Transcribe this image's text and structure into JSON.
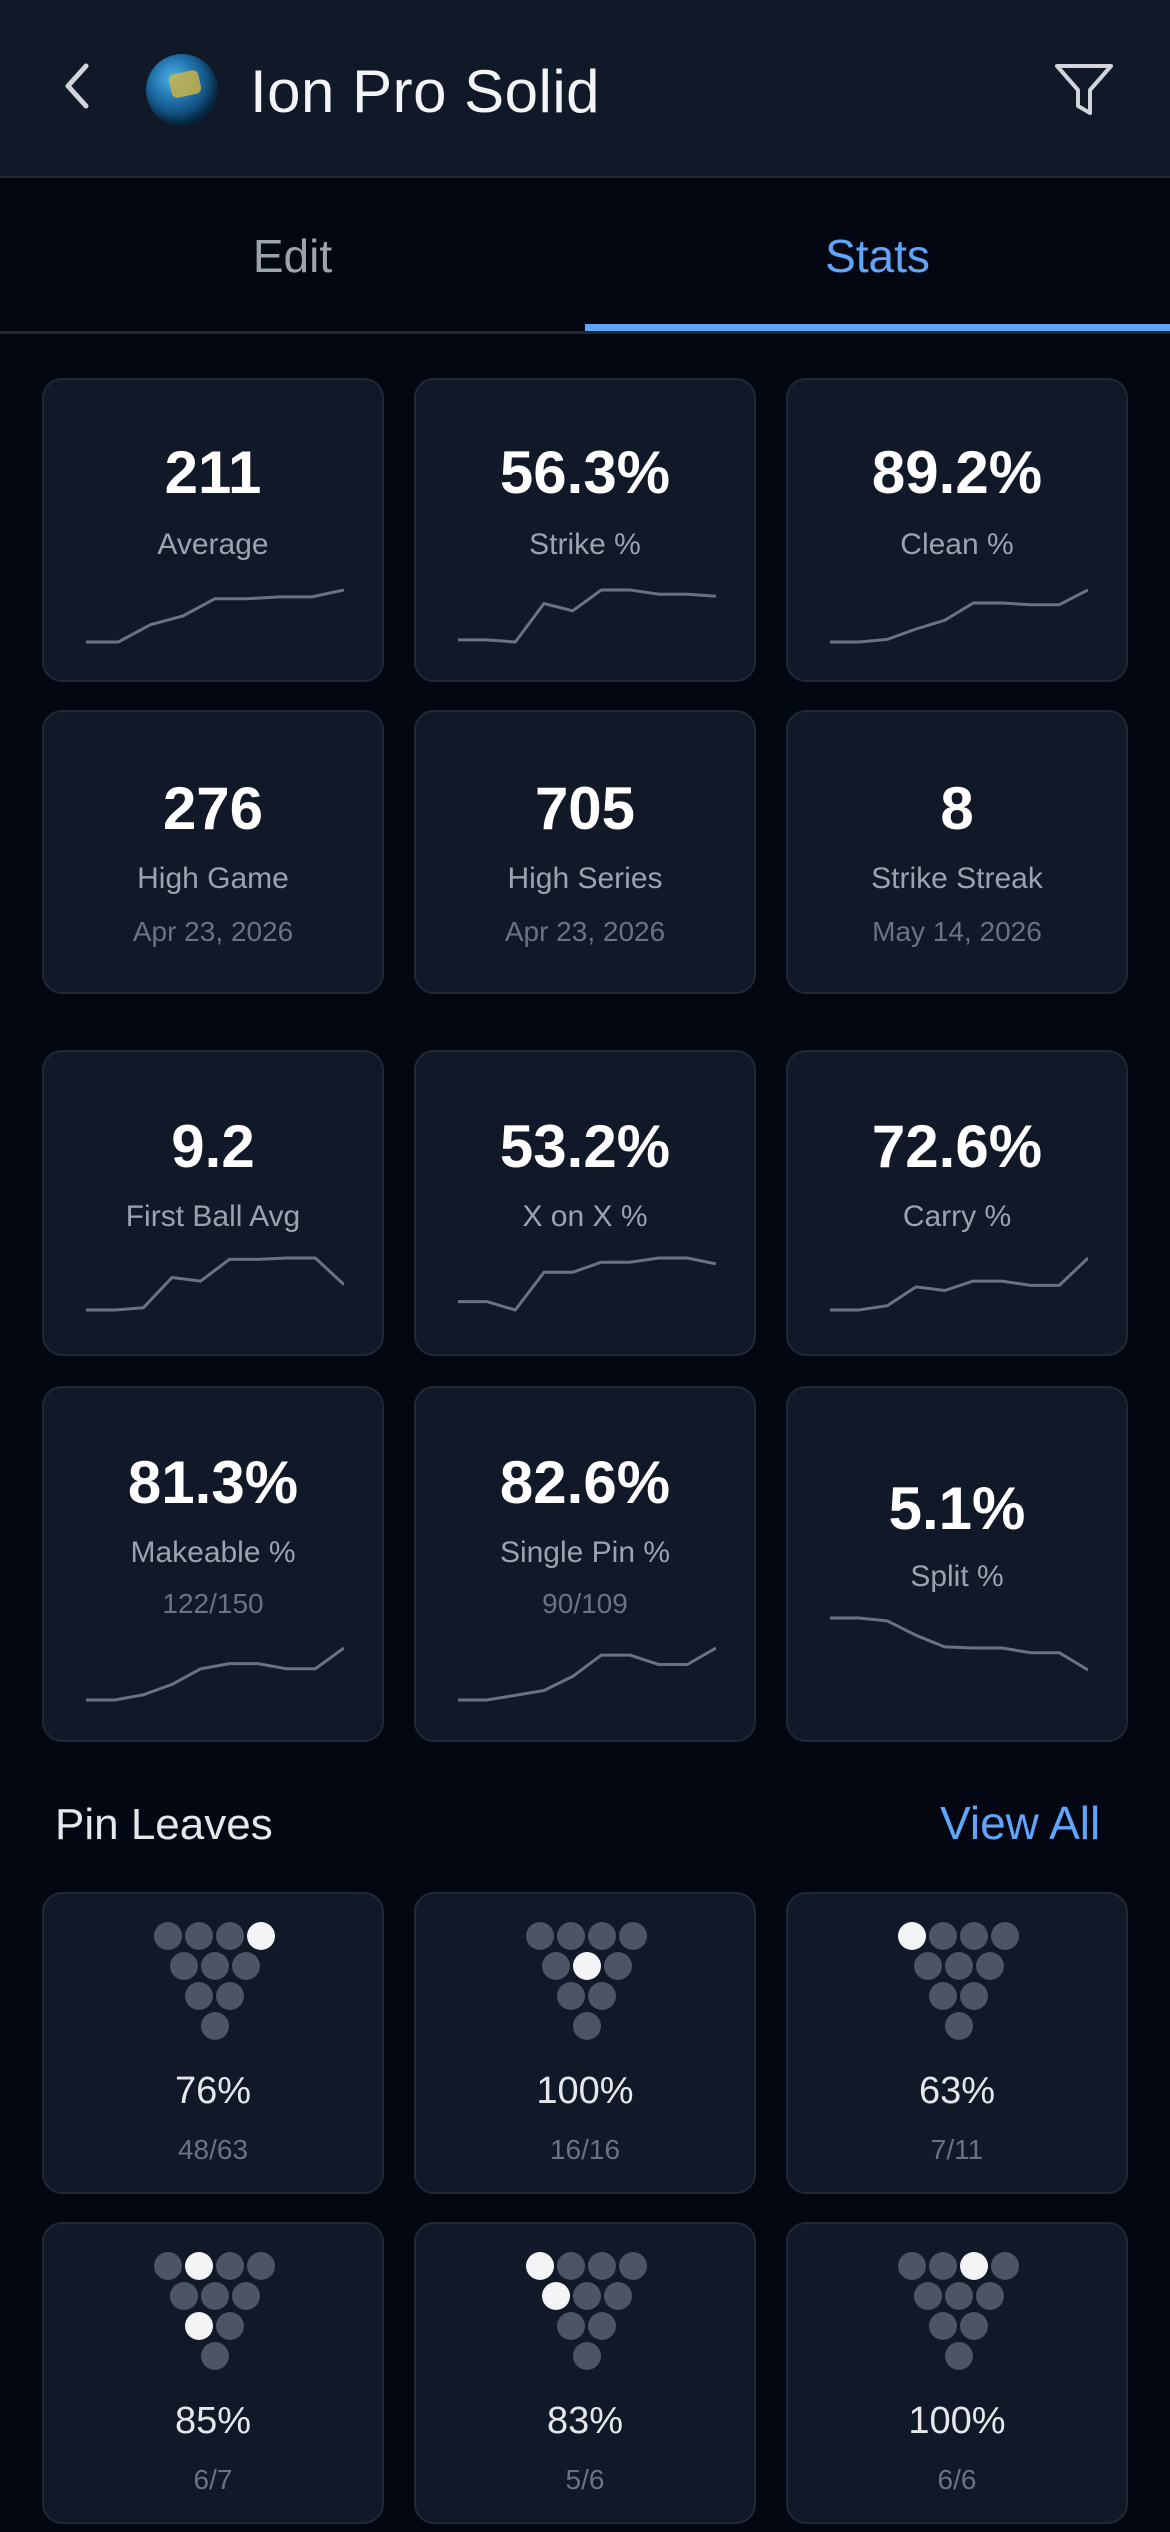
{
  "header": {
    "title": "Ion Pro Solid",
    "back_icon": "chevron-left-icon",
    "filter_icon": "filter-icon"
  },
  "tabs": [
    {
      "label": "Edit",
      "active": false
    },
    {
      "label": "Stats",
      "active": true
    }
  ],
  "colors": {
    "accent": "#60a5fa",
    "background": "#030712",
    "card": "#111827",
    "sparkline": "#6b7280",
    "pin_standing": "#4b5563",
    "pin_left": "#f3f4f6"
  },
  "stats_group1": [
    {
      "value": "211",
      "label": "Average",
      "trend": [
        0,
        0,
        2,
        3,
        5,
        5,
        5.2,
        5.2,
        6
      ]
    },
    {
      "value": "56.3%",
      "label": "Strike %",
      "trend": [
        1,
        1,
        0.8,
        4.5,
        3.8,
        5.8,
        5.8,
        5.4,
        5.4,
        5.2
      ]
    },
    {
      "value": "89.2%",
      "label": "Clean %",
      "trend": [
        0,
        0,
        0.3,
        1.5,
        2.5,
        4.5,
        4.5,
        4.3,
        4.3,
        6
      ]
    },
    {
      "value": "276",
      "label": "High Game",
      "sub": "Apr 23, 2026"
    },
    {
      "value": "705",
      "label": "High Series",
      "sub": "Apr 23, 2026"
    },
    {
      "value": "8",
      "label": "Strike Streak",
      "sub": "May 14, 2026"
    }
  ],
  "stats_group2": [
    {
      "value": "9.2",
      "label": "First Ball Avg",
      "trend": [
        0,
        0,
        0.3,
        4.5,
        4,
        7,
        7,
        7.2,
        7.2,
        3.5
      ]
    },
    {
      "value": "53.2%",
      "label": "X on X %",
      "trend": [
        1.5,
        1.5,
        0.5,
        5,
        5,
        6.2,
        6.2,
        6.7,
        6.7,
        6
      ]
    },
    {
      "value": "72.6%",
      "label": "Carry %",
      "trend": [
        0,
        0,
        0.6,
        3.2,
        2.7,
        4,
        4,
        3.4,
        3.4,
        7.2
      ]
    },
    {
      "value": "81.3%",
      "label": "Makeable %",
      "sub": "122/150",
      "trend": [
        0,
        0,
        1,
        3,
        6,
        7,
        7,
        6,
        6,
        10
      ]
    },
    {
      "value": "82.6%",
      "label": "Single Pin %",
      "sub": "90/109",
      "trend": [
        0,
        0,
        1,
        2,
        5,
        9.5,
        9.5,
        7.5,
        7.5,
        11
      ]
    },
    {
      "value": "5.1%",
      "label": "Split %",
      "trend": [
        10,
        10,
        9.5,
        7,
        5,
        4.8,
        4.8,
        4,
        4,
        1
      ]
    }
  ],
  "pin_leaves": {
    "title": "Pin Leaves",
    "view_all": "View All",
    "items": [
      {
        "left_pins": [
          10
        ],
        "percent": "76%",
        "fraction": "48/63"
      },
      {
        "left_pins": [
          5
        ],
        "percent": "100%",
        "fraction": "16/16"
      },
      {
        "left_pins": [
          7
        ],
        "percent": "63%",
        "fraction": "7/11"
      },
      {
        "left_pins": [
          2,
          8
        ],
        "percent": "85%",
        "fraction": "6/7"
      },
      {
        "left_pins": [
          7,
          4
        ],
        "percent": "83%",
        "fraction": "5/6"
      },
      {
        "left_pins": [
          9
        ],
        "percent": "100%",
        "fraction": "6/6"
      }
    ]
  }
}
